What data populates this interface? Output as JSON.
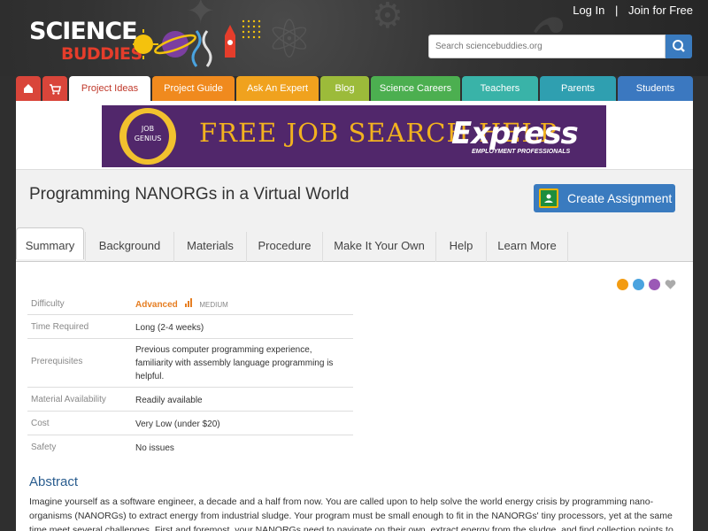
{
  "header": {
    "logo_line1": "SCIENCE",
    "logo_line2": "BUDDIES",
    "login": "Log In",
    "separator": "|",
    "join": "Join for Free",
    "search_placeholder": "Search sciencebuddies.org"
  },
  "nav": {
    "items": [
      {
        "label": "",
        "icon": "home-icon",
        "color": "#d9453a"
      },
      {
        "label": "",
        "icon": "cart-icon",
        "color": "#d9453a"
      },
      {
        "label": "Project Ideas",
        "color": "#ffffff"
      },
      {
        "label": "Project Guide",
        "color": "#f08a1e"
      },
      {
        "label": "Ask An Expert",
        "color": "#f0a21e"
      },
      {
        "label": "Blog",
        "color": "#9cbb3a"
      },
      {
        "label": "Science Careers",
        "color": "#4caf50"
      },
      {
        "label": "Teachers",
        "color": "#39b3a8"
      },
      {
        "label": "Parents",
        "color": "#2f9fb0"
      },
      {
        "label": "Students",
        "color": "#3b78c0"
      }
    ]
  },
  "ad": {
    "badge_line1": "JOB",
    "badge_line2": "GENIUS",
    "headline": "FREE JOB SEARCH HELP",
    "brand": "Express",
    "brand_sub": "EMPLOYMENT PROFESSIONALS"
  },
  "page": {
    "title": "Programming NANORGs in a Virtual World",
    "assign_button": "Create Assignment"
  },
  "tabs": [
    "Summary",
    "Background",
    "Materials",
    "Procedure",
    "Make It Your Own",
    "Help",
    "Learn More"
  ],
  "summary": {
    "difficulty_label": "Difficulty",
    "difficulty_value": "Advanced",
    "difficulty_level": "MEDIUM",
    "time_label": "Time Required",
    "time_value": "Long (2-4 weeks)",
    "prereq_label": "Prerequisites",
    "prereq_value": "Previous computer programming experience, familiarity with assembly language programming is helpful.",
    "material_label": "Material Availability",
    "material_value": "Readily available",
    "cost_label": "Cost",
    "cost_value": "Very Low (under $20)",
    "safety_label": "Safety",
    "safety_value": "No issues"
  },
  "abstract": {
    "heading": "Abstract",
    "text": "Imagine yourself as a software engineer, a decade and a half from now. You are called upon to help solve the world energy crisis by programming nano-organisms (NANORGs) to extract energy from industrial sludge. Your program must be small enough to fit in the NANORGs' tiny processors, yet at the same time meet several challenges. First and foremost, your NANORGs need to navigate on their own, extract energy from the sludge, and find collection points to deliver the"
  }
}
